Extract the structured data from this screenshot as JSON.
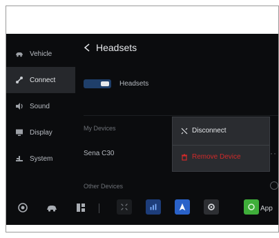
{
  "header": {
    "title": "Headsets"
  },
  "sidebar": {
    "items": [
      {
        "label": "Vehicle",
        "icon": "car-icon"
      },
      {
        "label": "Connect",
        "icon": "connect-icon"
      },
      {
        "label": "Sound",
        "icon": "speaker-icon"
      },
      {
        "label": "Display",
        "icon": "display-icon"
      },
      {
        "label": "System",
        "icon": "system-icon"
      }
    ],
    "active_index": 1
  },
  "main": {
    "toggle_label": "Headsets",
    "toggle_on": true,
    "my_devices_label": "My Devices",
    "device_name": "Sena C30",
    "other_devices_label": "Other Devices"
  },
  "popup": {
    "disconnect_label": "Disconnect",
    "remove_label": "Remove Device"
  },
  "bottombar": {
    "app_label": "App"
  },
  "colors": {
    "accent_blue": "#2a62c9",
    "danger_red": "#d02a2a",
    "app_green": "#3fae3a"
  }
}
